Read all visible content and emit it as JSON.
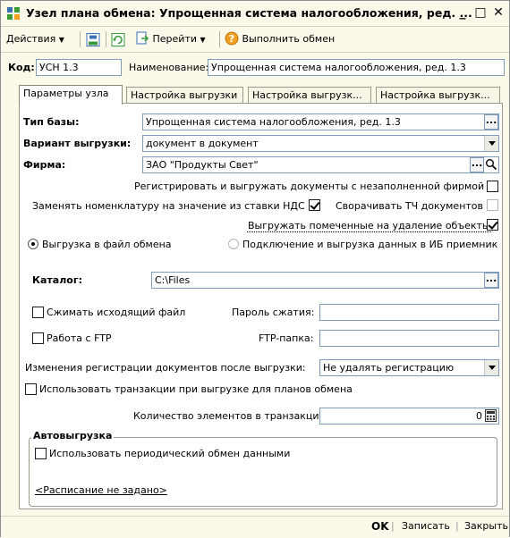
{
  "window": {
    "title": "Узел плана обмена: Упрощенная система налогообложения, ред. ...",
    "controls": [
      "_",
      "□",
      "✕"
    ]
  },
  "toolbar": {
    "actions_label": "Действия",
    "goto_label": "Перейти",
    "run_exchange_label": "Выполнить обмен"
  },
  "header": {
    "code_label": "Код:",
    "code_value": "УСН 1.3",
    "name_label": "Наименование:",
    "name_value": "Упрощенная система налогообложения, ред. 1.3"
  },
  "tabs": [
    {
      "label": "Параметры узла"
    },
    {
      "label": "Настройка выгрузки"
    },
    {
      "label": "Настройка выгрузк..."
    },
    {
      "label": "Настройка выгрузк..."
    }
  ],
  "params": {
    "base_type_label": "Тип базы:",
    "base_type_value": "Упрощенная система налогообложения, ред. 1.3",
    "export_variant_label": "Вариант выгрузки:",
    "export_variant_value": "документ в документ",
    "firm_label": "Фирма:",
    "firm_value": "ЗАО \"Продукты Свет\"",
    "register_unfilled_firm_label": "Регистрировать и выгружать документы с незаполненной фирмой",
    "register_unfilled_firm_checked": false,
    "replace_nomenclature_label": "Заменять номенклатуру на значение из ставки НДС",
    "replace_nomenclature_checked": true,
    "collapse_tc_label": "Сворачивать ТЧ документов",
    "collapse_tc_checked": false,
    "export_deleted_label": "Выгружать помеченные на удаление объекты",
    "export_deleted_checked": true,
    "radio_file_label": "Выгрузка в файл обмена",
    "radio_file_selected": true,
    "radio_ib_label": "Подключение и выгрузка данных в ИБ приемник",
    "radio_ib_selected": false,
    "catalog_label": "Каталог:",
    "catalog_value": "C:\\Files",
    "compress_label": "Сжимать исходящий файл",
    "compress_checked": false,
    "compress_password_label": "Пароль сжатия:",
    "compress_password_value": "",
    "ftp_label": "Работа с FTP",
    "ftp_checked": false,
    "ftp_folder_label": "FTP-папка:",
    "ftp_folder_value": "",
    "reg_changes_label": "Изменения регистрации документов после выгрузки:",
    "reg_changes_value": "Не удалять регистрацию",
    "use_transactions_label": "Использовать транзакции при выгрузке для планов обмена",
    "use_transactions_checked": false,
    "tx_count_label": "Количество элементов в транзакции:",
    "tx_count_value": "0"
  },
  "auto_export": {
    "title": "Автовыгрузка",
    "periodic_label": "Использовать периодический обмен данными",
    "periodic_checked": false,
    "schedule_link": "<Расписание не задано>"
  },
  "footer": {
    "ok_label": "OK",
    "save_label": "Записать",
    "close_label": "Закрыть"
  },
  "colors": {
    "window_bg": "#fbf9ea",
    "panel_bg": "#ffffff",
    "input_border": "#7f9db9",
    "icon_green": "#3a9a3a",
    "icon_blue": "#3b6fb6",
    "help_orange": "#f0a020"
  }
}
